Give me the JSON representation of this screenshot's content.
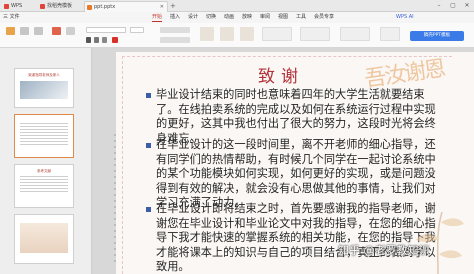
{
  "tabs": [
    {
      "label": "WPS Office",
      "color": "#e0453a"
    },
    {
      "label": "找稻壳模板",
      "color": "#e0453a"
    },
    {
      "label": "ppt.pptx",
      "color": "#e8792b",
      "active": true
    }
  ],
  "menu": {
    "file_label": "三 文件",
    "items": [
      "开始",
      "插入",
      "设计",
      "切换",
      "动画",
      "放映",
      "审阅",
      "视图",
      "工具",
      "会员专享"
    ],
    "active": "开始",
    "brand": "WPS AI"
  },
  "ribbon": {
    "share_label": "稿壳PPT模板"
  },
  "thumbnails": {
    "numbers": [
      "",
      "",
      "",
      ""
    ],
    "items": [
      {
        "title": "致谢指导老师及家人",
        "selected": false
      },
      {
        "title": "",
        "selected": true
      },
      {
        "title": "参考文献",
        "selected": false
      },
      {
        "title": "",
        "selected": false
      }
    ]
  },
  "slide": {
    "title": "致谢",
    "decoration": "吾汝谢恩",
    "paragraphs": [
      "毕业设计结束的同时也意味着四年的大学生活就要结束了。在线拍卖系统的完成以及如何在系统运行过程中实现的更好，这其中我也付出了很大的努力，这段时光将会终身难忘。",
      "在毕业设计的这一段时间里，离不开老师的细心指导，还有同学们的热情帮助，有时候几个同学在一起讨论系统中的某个功能模块如何实现，如何更好的实现，或是问题没得到有效的解决，就会没有心思做其他的事情，让我们对学习充满了动力。",
      "在毕业设计即将结束之时，首先要感谢我的指导老师，谢谢您在毕业设计和毕业论文中对我的指导，在您的细心指导下我才能快速的掌握系统的相关功能，在您的指导下我才能将课本上的知识与自己的项目结合，真正的做到学以致用。"
    ],
    "bullet_color": "#3a5ea8",
    "title_color": "#b2323b"
  },
  "watermark": "知乎 @老罗教知识"
}
